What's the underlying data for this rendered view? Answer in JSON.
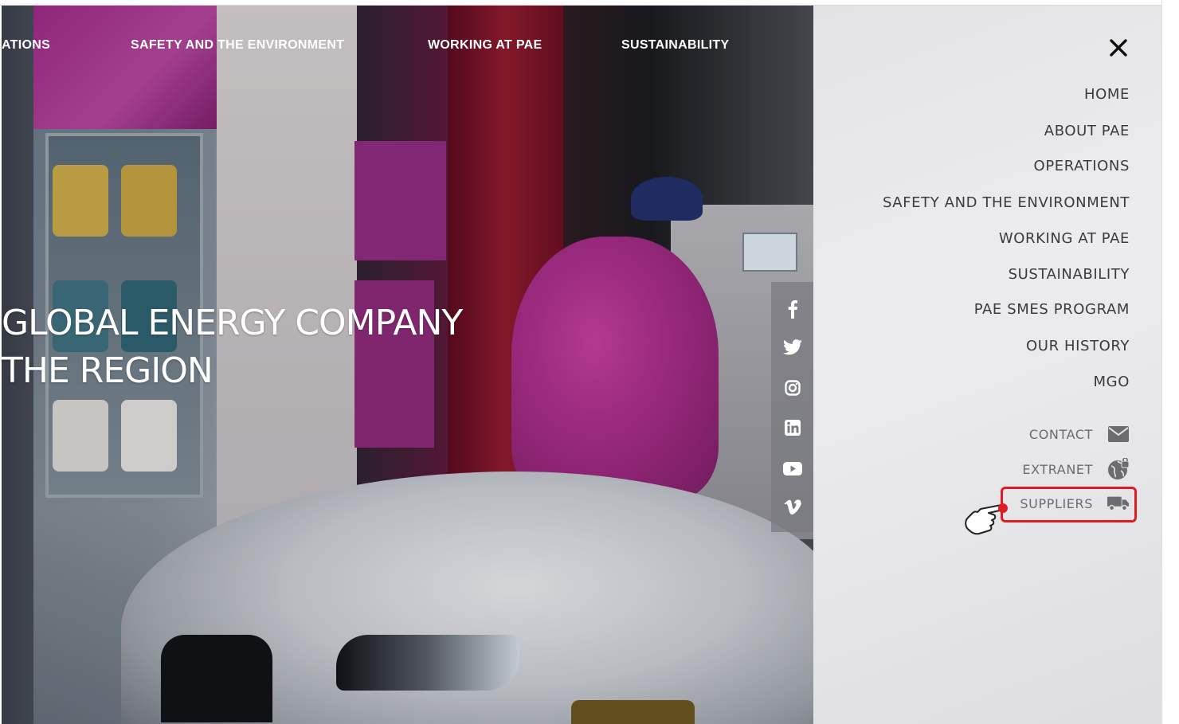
{
  "top_nav": {
    "items": [
      {
        "label": "ATIONS"
      },
      {
        "label": "SAFETY AND THE ENVIRONMENT"
      },
      {
        "label": "WORKING AT PAE"
      },
      {
        "label": "SUSTAINABILITY"
      }
    ]
  },
  "hero": {
    "headline_line1": "GLOBAL ENERGY COMPANY",
    "headline_line2": "THE REGION"
  },
  "social": {
    "icons": [
      "facebook-icon",
      "twitter-icon",
      "instagram-icon",
      "linkedin-icon",
      "youtube-icon",
      "vimeo-icon"
    ]
  },
  "side_menu": {
    "items": [
      {
        "label": "HOME"
      },
      {
        "label": "ABOUT PAE"
      },
      {
        "label": "OPERATIONS"
      },
      {
        "label": "SAFETY AND THE ENVIRONMENT"
      },
      {
        "label": "WORKING AT PAE"
      },
      {
        "label": "SUSTAINABILITY"
      },
      {
        "label": "PAE SMES PROGRAM"
      },
      {
        "label": "OUR HISTORY"
      },
      {
        "label": "MGO"
      }
    ],
    "utility": [
      {
        "label": "CONTACT",
        "icon": "envelope-icon"
      },
      {
        "label": "EXTRANET",
        "icon": "globe-lock-icon"
      },
      {
        "label": "SUPPLIERS",
        "icon": "truck-icon"
      }
    ]
  },
  "colors": {
    "highlight": "#e11b22",
    "menu_text": "#3b3b3f",
    "menu_bg": "#e6e6e8"
  }
}
